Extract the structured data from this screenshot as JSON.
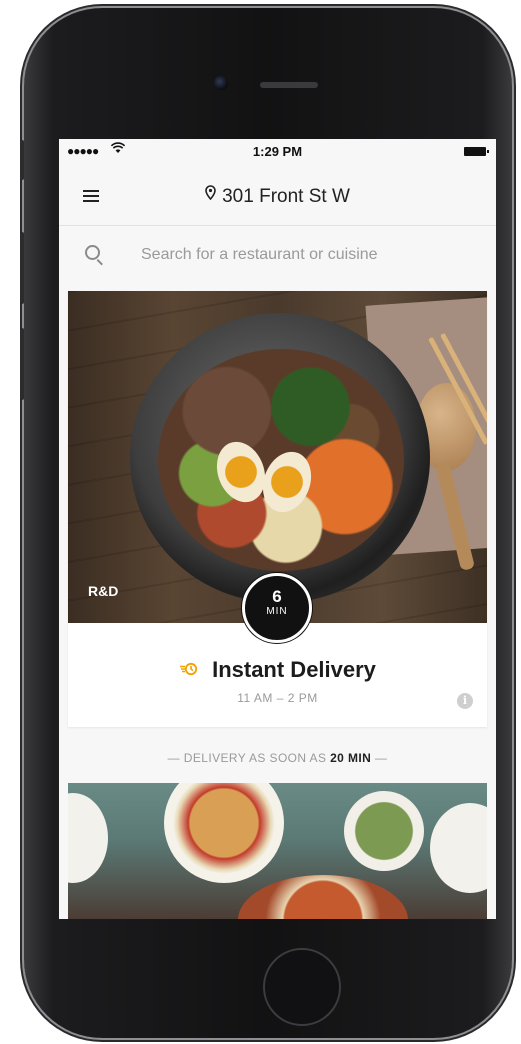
{
  "status_bar": {
    "signal": "●●●●●",
    "wifi_icon": "wifi-icon",
    "time": "1:29 PM",
    "battery_icon": "battery-icon"
  },
  "header": {
    "menu_icon": "hamburger-menu-icon",
    "location_icon": "map-pin-icon",
    "address": "301 Front St W"
  },
  "search": {
    "icon": "search-icon",
    "placeholder": "Search for a restaurant or cuisine",
    "value": ""
  },
  "featured_card": {
    "restaurant_label": "R&D",
    "eta": {
      "value": "6",
      "unit": "MIN"
    },
    "title_icon": "instant-delivery-icon",
    "title": "Instant Delivery",
    "hours": "11 AM – 2 PM",
    "info_icon": "info-icon",
    "accent_color": "#F2A100"
  },
  "section_separator": {
    "prefix": "— DELIVERY AS SOON AS ",
    "highlight": "20 MIN",
    "suffix": " —"
  }
}
